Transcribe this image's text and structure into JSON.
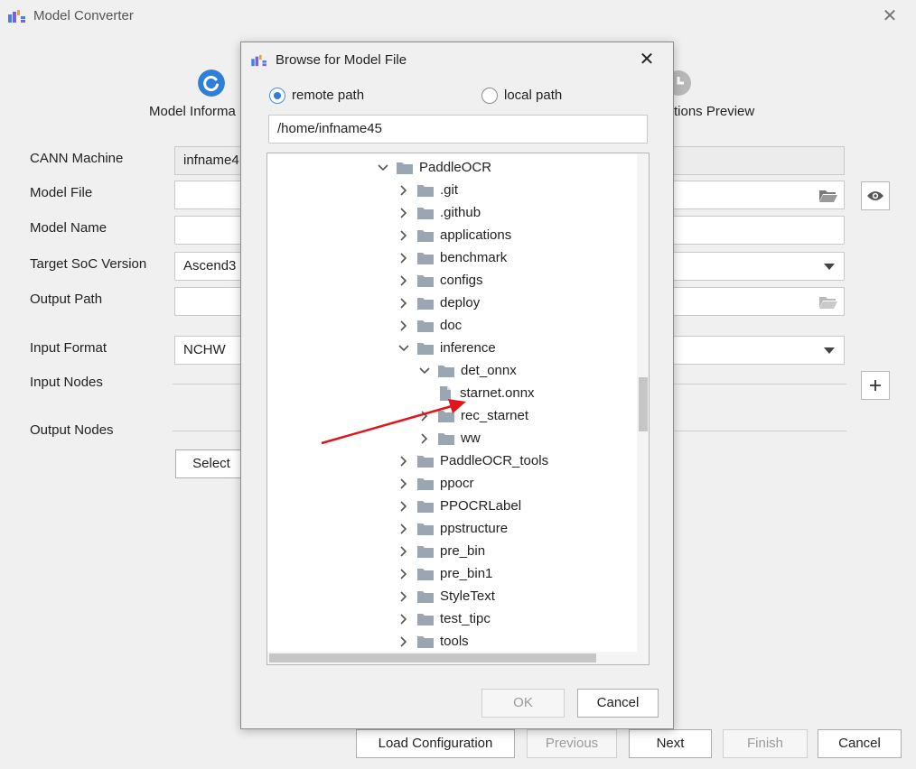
{
  "window": {
    "title": "Model Converter",
    "accent": "#2f7fd6"
  },
  "steps": {
    "first_label": "Model Informa",
    "last_label": "tions  Preview"
  },
  "form": {
    "cann_machine_label": "CANN Machine",
    "cann_machine_value": "infname4",
    "model_file_label": "Model File",
    "model_name_label": "Model Name",
    "target_soc_label": "Target SoC Version",
    "target_soc_value": "Ascend3",
    "output_path_label": "Output Path",
    "input_format_label": "Input Format",
    "input_format_value": "NCHW",
    "input_nodes_label": "Input Nodes",
    "output_nodes_label": "Output Nodes",
    "select_button": "Select"
  },
  "footer": {
    "load_configuration": "Load Configuration",
    "previous": "Previous",
    "next": "Next",
    "finish": "Finish",
    "cancel": "Cancel"
  },
  "dialog": {
    "title": "Browse for Model File",
    "remote_path_label": "remote path",
    "local_path_label": "local path",
    "selected_source": "remote path",
    "path_value": "/home/infname45",
    "ok": "OK",
    "cancel": "Cancel",
    "tree": [
      {
        "label": "PaddleOCR",
        "depth": 0,
        "type": "folder",
        "expanded": true
      },
      {
        "label": ".git",
        "depth": 1,
        "type": "folder",
        "expanded": false
      },
      {
        "label": ".github",
        "depth": 1,
        "type": "folder",
        "expanded": false
      },
      {
        "label": "applications",
        "depth": 1,
        "type": "folder",
        "expanded": false
      },
      {
        "label": "benchmark",
        "depth": 1,
        "type": "folder",
        "expanded": false
      },
      {
        "label": "configs",
        "depth": 1,
        "type": "folder",
        "expanded": false
      },
      {
        "label": "deploy",
        "depth": 1,
        "type": "folder",
        "expanded": false
      },
      {
        "label": "doc",
        "depth": 1,
        "type": "folder",
        "expanded": false
      },
      {
        "label": "inference",
        "depth": 1,
        "type": "folder",
        "expanded": true
      },
      {
        "label": "det_onnx",
        "depth": 2,
        "type": "folder",
        "expanded": true
      },
      {
        "label": "starnet.onnx",
        "depth": 3,
        "type": "file",
        "expanded": false
      },
      {
        "label": "rec_starnet",
        "depth": 2,
        "type": "folder",
        "expanded": false
      },
      {
        "label": "ww",
        "depth": 2,
        "type": "folder",
        "expanded": false
      },
      {
        "label": "PaddleOCR_tools",
        "depth": 1,
        "type": "folder",
        "expanded": false
      },
      {
        "label": "ppocr",
        "depth": 1,
        "type": "folder",
        "expanded": false
      },
      {
        "label": "PPOCRLabel",
        "depth": 1,
        "type": "folder",
        "expanded": false
      },
      {
        "label": "ppstructure",
        "depth": 1,
        "type": "folder",
        "expanded": false
      },
      {
        "label": "pre_bin",
        "depth": 1,
        "type": "folder",
        "expanded": false
      },
      {
        "label": "pre_bin1",
        "depth": 1,
        "type": "folder",
        "expanded": false
      },
      {
        "label": "StyleText",
        "depth": 1,
        "type": "folder",
        "expanded": false
      },
      {
        "label": "test_tipc",
        "depth": 1,
        "type": "folder",
        "expanded": false
      },
      {
        "label": "tools",
        "depth": 1,
        "type": "folder",
        "expanded": false
      }
    ]
  },
  "annotation": {
    "arrow_color": "#e0161b",
    "icon_color": "#9aa6b2"
  }
}
